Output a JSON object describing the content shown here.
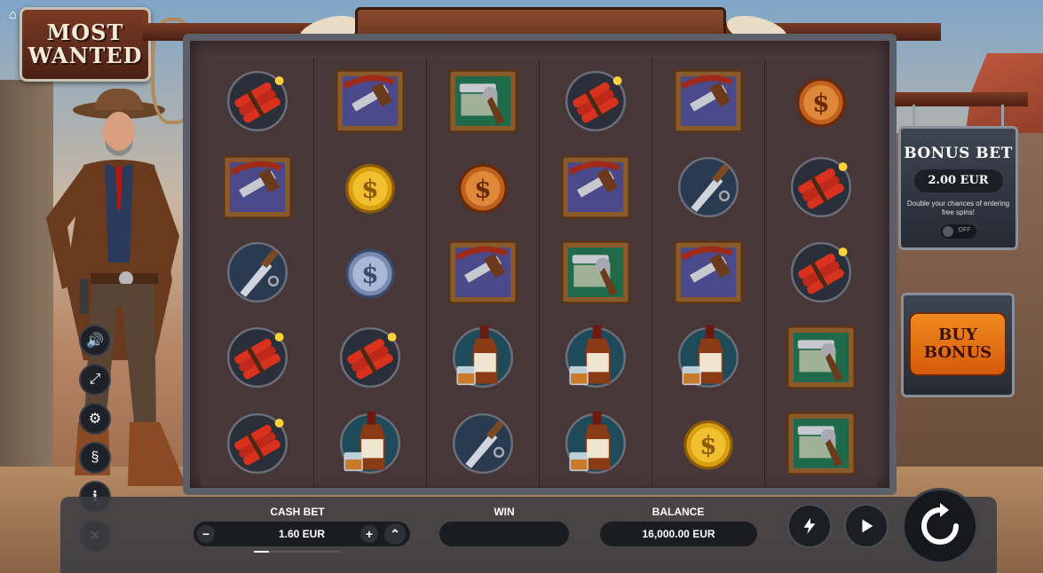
{
  "game": {
    "logo_line1": "MOST",
    "logo_line2": "WANTED"
  },
  "bonus_bet": {
    "title": "BONUS BET",
    "amount": "2.00 EUR",
    "description": "Double your chances of entering free spins!",
    "toggle_label": "OFF",
    "toggle_on": false
  },
  "buy_bonus": {
    "line1": "BUY",
    "line2": "BONUS"
  },
  "bottom_bar": {
    "cash_bet_label": "CASH BET",
    "cash_bet_value": "1.60 EUR",
    "win_label": "WIN",
    "win_value": "",
    "balance_label": "BALANCE",
    "balance_value": "16,000.00 EUR",
    "bet_slider_fraction": 0.17
  },
  "side_controls": [
    "sound-icon",
    "fullscreen-icon",
    "settings-icon",
    "paytable-icon",
    "info-icon",
    "close-icon"
  ],
  "grid_symbols": [
    [
      "dynamite",
      "shotgun",
      "revolver",
      "dynamite",
      "shotgun",
      "bronze-coin"
    ],
    [
      "shotgun",
      "gold-coin",
      "bronze-coin",
      "shotgun",
      "knife",
      "dynamite"
    ],
    [
      "knife",
      "silver-coin",
      "shotgun",
      "revolver",
      "shotgun",
      "dynamite"
    ],
    [
      "dynamite",
      "dynamite",
      "whiskey",
      "whiskey",
      "whiskey",
      "revolver"
    ],
    [
      "dynamite",
      "whiskey",
      "knife",
      "whiskey",
      "gold-coin",
      "revolver"
    ]
  ],
  "colors": {
    "bonus_orange": "#e8771a",
    "panel_dark": "#1a1c21"
  }
}
